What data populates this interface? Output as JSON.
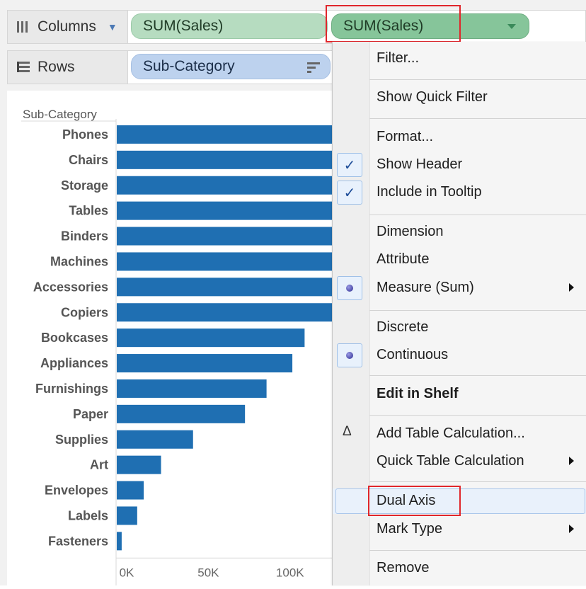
{
  "shelves": {
    "columns_label": "Columns",
    "rows_label": "Rows",
    "columns_pills": [
      "SUM(Sales)",
      "SUM(Sales)"
    ],
    "rows_pill": "Sub-Category"
  },
  "chart_data": {
    "type": "bar",
    "orientation": "horizontal",
    "title": "",
    "ylabel": "Sub-Category",
    "categories": [
      "Phones",
      "Chairs",
      "Storage",
      "Tables",
      "Binders",
      "Machines",
      "Accessories",
      "Copiers",
      "Bookcases",
      "Appliances",
      "Furnishings",
      "Paper",
      "Supplies",
      "Art",
      "Envelopes",
      "Labels",
      "Fasteners"
    ],
    "values": [
      330000,
      328000,
      224000,
      207000,
      203000,
      189000,
      167000,
      150000,
      115000,
      107500,
      91700,
      78500,
      46700,
      27100,
      16500,
      12500,
      3000
    ],
    "xlim": [
      0,
      130000
    ],
    "xticks": [
      0,
      50000,
      100000
    ],
    "xtick_labels": [
      "0K",
      "50K",
      "100K"
    ],
    "bar_color": "#1f6fb2",
    "grid": false
  },
  "menu": {
    "items": [
      {
        "label": "Filter...",
        "marker": "",
        "submenu": false,
        "bold": false
      },
      {
        "label": "Show Quick Filter",
        "marker": "",
        "submenu": false,
        "bold": false
      },
      {
        "label": "Format...",
        "marker": "",
        "submenu": false,
        "bold": false
      },
      {
        "label": "Show Header",
        "marker": "check",
        "submenu": false,
        "bold": false
      },
      {
        "label": "Include in Tooltip",
        "marker": "check",
        "submenu": false,
        "bold": false
      },
      {
        "label": "Dimension",
        "marker": "",
        "submenu": false,
        "bold": false
      },
      {
        "label": "Attribute",
        "marker": "",
        "submenu": false,
        "bold": false
      },
      {
        "label": "Measure (Sum)",
        "marker": "dot",
        "submenu": true,
        "bold": false
      },
      {
        "label": "Discrete",
        "marker": "",
        "submenu": false,
        "bold": false
      },
      {
        "label": "Continuous",
        "marker": "dot",
        "submenu": false,
        "bold": false
      },
      {
        "label": "Edit in Shelf",
        "marker": "",
        "submenu": false,
        "bold": true
      },
      {
        "label": "Add Table Calculation...",
        "marker": "delta",
        "submenu": false,
        "bold": false
      },
      {
        "label": "Quick Table Calculation",
        "marker": "",
        "submenu": true,
        "bold": false
      },
      {
        "label": "Dual Axis",
        "marker": "",
        "submenu": false,
        "bold": false,
        "hovered": true
      },
      {
        "label": "Mark Type",
        "marker": "",
        "submenu": true,
        "bold": false
      },
      {
        "label": "Remove",
        "marker": "",
        "submenu": false,
        "bold": false
      }
    ]
  },
  "colors": {
    "bar": "#1f6fb2",
    "highlight": "#e0262b",
    "check": "#1f4e99"
  }
}
